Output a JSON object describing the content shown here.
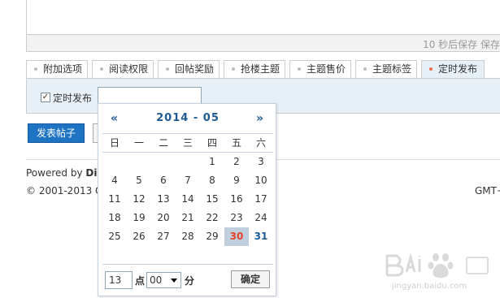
{
  "editor": {
    "autosave_status": "10 秒后保存 保存"
  },
  "tabs": [
    {
      "label": "附加选项"
    },
    {
      "label": "阅读权限"
    },
    {
      "label": "回帖奖励"
    },
    {
      "label": "抢楼主题"
    },
    {
      "label": "主题售价"
    },
    {
      "label": "主题标签"
    },
    {
      "label": "定时发布",
      "active": true
    }
  ],
  "schedule": {
    "checkbox_label": "定时发布",
    "checked": true,
    "date_value": ""
  },
  "actions": {
    "submit_label": "发表帖子"
  },
  "footer": {
    "powered_prefix": "Powered by ",
    "powered_brand": "Dis",
    "copyright": "© 2001-2013 C",
    "timezone": "GMT+"
  },
  "calendar": {
    "prev": "«",
    "next": "»",
    "year": "2014",
    "separator": "-",
    "month": "05",
    "weekdays": [
      "日",
      "一",
      "二",
      "三",
      "四",
      "五",
      "六"
    ],
    "weeks": [
      [
        "",
        "",
        "",
        "",
        "1",
        "2",
        "3"
      ],
      [
        "4",
        "5",
        "6",
        "7",
        "8",
        "9",
        "10"
      ],
      [
        "11",
        "12",
        "13",
        "14",
        "15",
        "16",
        "17"
      ],
      [
        "18",
        "19",
        "20",
        "21",
        "22",
        "23",
        "24"
      ],
      [
        "25",
        "26",
        "27",
        "28",
        "29",
        "30",
        "31"
      ]
    ],
    "selected_day": "30",
    "next_month_day": "31",
    "hour_value": "13",
    "hour_unit": "点",
    "minute_value": "00",
    "minute_unit": "分",
    "confirm_label": "确定"
  },
  "watermark": {
    "text": "Bai",
    "suffix": "经验",
    "url": "jingyan.baidu.com"
  },
  "colors": {
    "accent": "#1e74c2",
    "selected_day": "#e5432b",
    "tab_active_bg": "#e8f0f7"
  }
}
